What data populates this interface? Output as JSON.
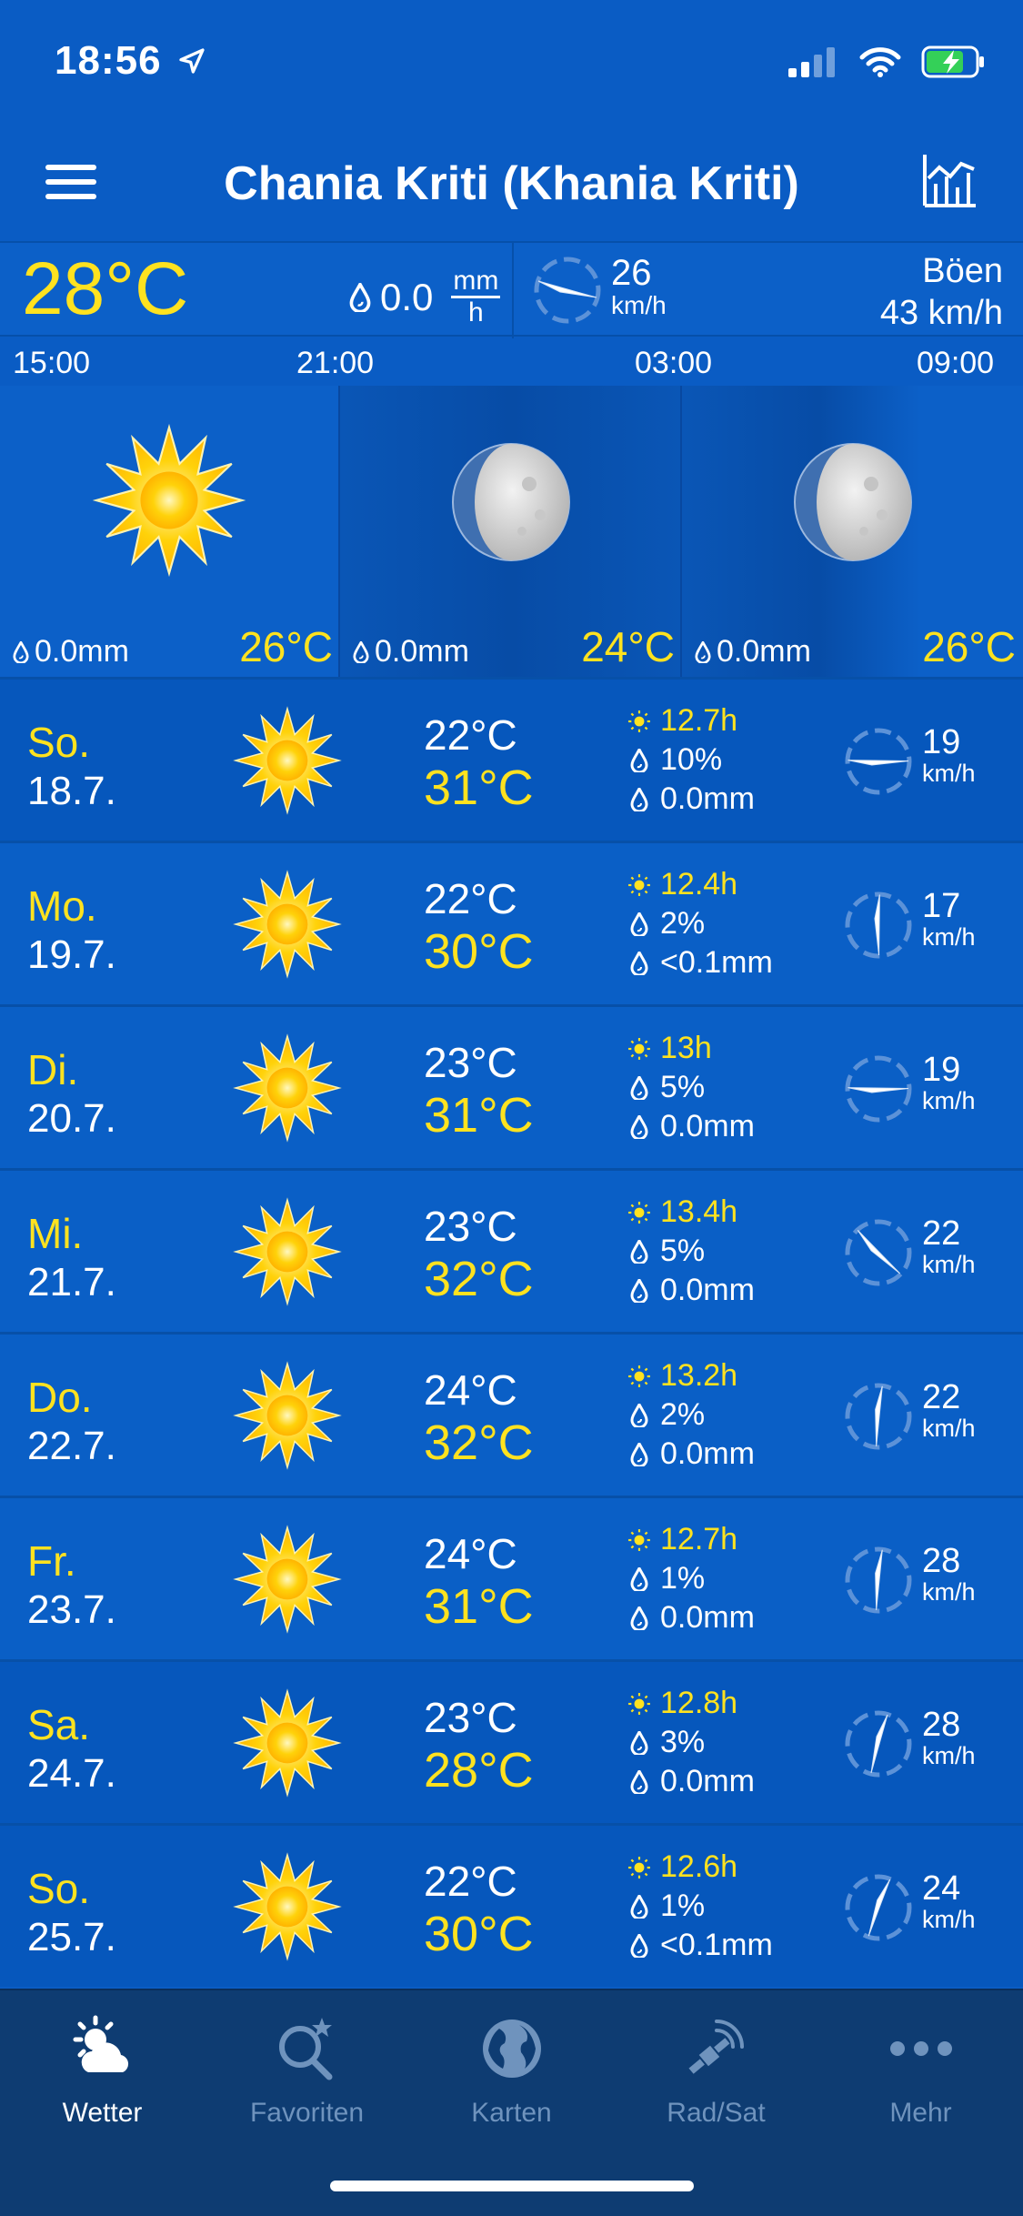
{
  "status": {
    "time": "18:56"
  },
  "header": {
    "title": "Chania Kriti (Khania Kriti)"
  },
  "current": {
    "temperature": "28°C",
    "rain": "0.0",
    "rain_unit_num": "mm",
    "rain_unit_den": "h",
    "wind_speed": "26",
    "wind_unit": "km/h",
    "gusts_label": "Böen",
    "gusts_value": "43 km/h"
  },
  "hourly": {
    "labels": [
      "15:00",
      "21:00",
      "03:00",
      "09:00"
    ],
    "slots": [
      {
        "rain": "0.0mm",
        "temp": "26°C"
      },
      {
        "rain": "0.0mm",
        "temp": "24°C"
      },
      {
        "rain": "0.0mm",
        "temp": "26°C"
      }
    ]
  },
  "days": [
    {
      "name": "So.",
      "date": "18.7.",
      "min": "22°C",
      "max": "31°C",
      "sun": "12.7h",
      "precip_prob": "10%",
      "precip": "0.0mm",
      "wind": "19",
      "wind_unit": "km/h"
    },
    {
      "name": "Mo.",
      "date": "19.7.",
      "min": "22°C",
      "max": "30°C",
      "sun": "12.4h",
      "precip_prob": "2%",
      "precip": "<0.1mm",
      "wind": "17",
      "wind_unit": "km/h"
    },
    {
      "name": "Di.",
      "date": "20.7.",
      "min": "23°C",
      "max": "31°C",
      "sun": "13h",
      "precip_prob": "5%",
      "precip": "0.0mm",
      "wind": "19",
      "wind_unit": "km/h"
    },
    {
      "name": "Mi.",
      "date": "21.7.",
      "min": "23°C",
      "max": "32°C",
      "sun": "13.4h",
      "precip_prob": "5%",
      "precip": "0.0mm",
      "wind": "22",
      "wind_unit": "km/h"
    },
    {
      "name": "Do.",
      "date": "22.7.",
      "min": "24°C",
      "max": "32°C",
      "sun": "13.2h",
      "precip_prob": "2%",
      "precip": "0.0mm",
      "wind": "22",
      "wind_unit": "km/h"
    },
    {
      "name": "Fr.",
      "date": "23.7.",
      "min": "24°C",
      "max": "31°C",
      "sun": "12.7h",
      "precip_prob": "1%",
      "precip": "0.0mm",
      "wind": "28",
      "wind_unit": "km/h"
    },
    {
      "name": "Sa.",
      "date": "24.7.",
      "min": "23°C",
      "max": "28°C",
      "sun": "12.8h",
      "precip_prob": "3%",
      "precip": "0.0mm",
      "wind": "28",
      "wind_unit": "km/h"
    },
    {
      "name": "So.",
      "date": "25.7.",
      "min": "22°C",
      "max": "30°C",
      "sun": "12.6h",
      "precip_prob": "1%",
      "precip": "<0.1mm",
      "wind": "24",
      "wind_unit": "km/h"
    }
  ],
  "tabs": [
    {
      "label": "Wetter",
      "icon": "weather-icon"
    },
    {
      "label": "Favoriten",
      "icon": "favorites-search-icon"
    },
    {
      "label": "Karten",
      "icon": "globe-icon"
    },
    {
      "label": "Rad/Sat",
      "icon": "satellite-icon"
    },
    {
      "label": "Mehr",
      "icon": "more-dots-icon"
    }
  ],
  "colors": {
    "background": "#0a5cc4",
    "accent": "#ffe21f",
    "tabbar": "#0e3c72"
  }
}
